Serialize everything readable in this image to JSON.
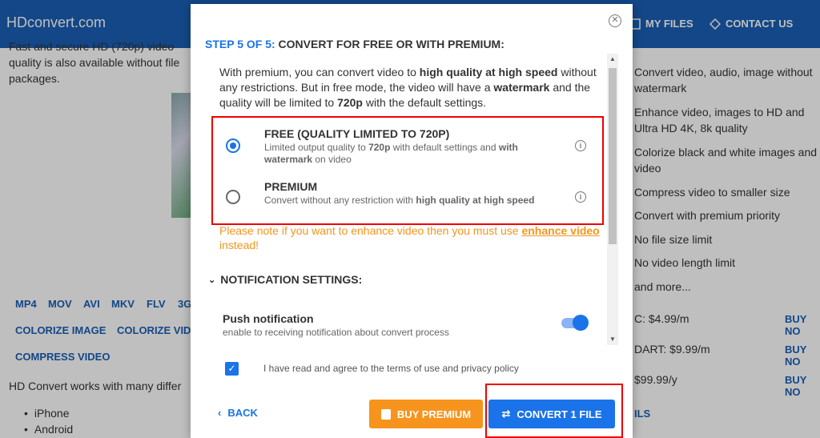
{
  "header": {
    "brand": "HDconvert.com",
    "my_files": "MY FILES",
    "contact_us": "CONTACT US"
  },
  "background": {
    "left_text_1": "Fast and secure HD (720p) video",
    "left_text_2": "quality is also available without file",
    "left_text_3": "packages.",
    "format_links": [
      "MP4",
      "MOV",
      "AVI",
      "MKV",
      "FLV",
      "3G"
    ],
    "link_colorize_image": "COLORIZE IMAGE",
    "link_colorize_video": "COLORIZE VID",
    "link_compress_video": "COMPRESS VIDEO",
    "support_text": "HD Convert works with many differ",
    "bullets": [
      "iPhone",
      "Android"
    ],
    "features": [
      "Convert video, audio, image without watermark",
      "Enhance video, images to HD and Ultra HD 4K, 8k quality",
      "Colorize black and white images and video",
      "Compress video to smaller size",
      "Convert with premium priority",
      "No file size limit",
      "No video length limit",
      "and more..."
    ],
    "prices": [
      {
        "label": "C: $4.99/m",
        "buy": "BUY NO"
      },
      {
        "label": "DART: $9.99/m",
        "buy": "BUY NO"
      },
      {
        "label": "$99.99/y",
        "buy": "BUY NO"
      }
    ],
    "bottom_link": "ILS"
  },
  "modal": {
    "step_prefix": "STEP 5 OF 5:",
    "step_title": " CONVERT FOR FREE OR WITH PREMIUM:",
    "intro_1": "With premium, you can convert video to ",
    "intro_b1": "high quality at high speed",
    "intro_2": " without any restrictions. But in free mode, the video will have a ",
    "intro_b2": "watermark",
    "intro_3": " and the quality will be limited to ",
    "intro_b3": "720p",
    "intro_4": " with the default settings.",
    "free": {
      "title": "FREE (QUALITY LIMITED TO 720P)",
      "desc_1": "Limited output quality to ",
      "desc_b1": "720p",
      "desc_2": " with default settings and ",
      "desc_b2": "with watermark",
      "desc_3": " on video"
    },
    "premium": {
      "title": "PREMIUM",
      "desc_1": "Convert without any restriction with ",
      "desc_b1": "high quality at high speed"
    },
    "note_1": "Please note if you want to enhance video then you must use ",
    "note_link": "enhance video",
    "note_2": " instead!",
    "notif_header": "NOTIFICATION SETTINGS:",
    "push_title": "Push notification",
    "push_desc": "enable to receiving notification about convert process",
    "agree": "I have read and agree to the terms of use and privacy policy",
    "back": "BACK",
    "buy_premium": "BUY PREMIUM",
    "convert": "CONVERT 1 FILE"
  }
}
